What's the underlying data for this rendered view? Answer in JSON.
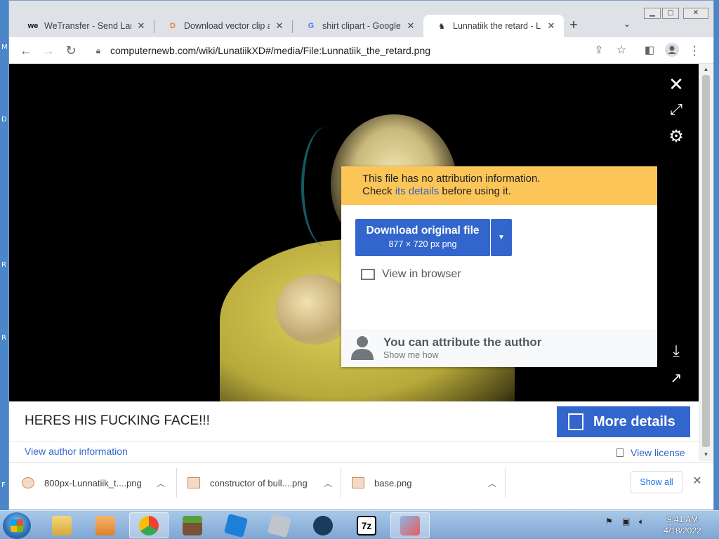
{
  "browser": {
    "tabs": [
      {
        "title": "WeTransfer - Send Large",
        "favicon": "wetransfer-icon"
      },
      {
        "title": "Download vector clip art",
        "favicon": "vector-site-icon"
      },
      {
        "title": "shirt clipart - Google Sea",
        "favicon": "google-icon"
      },
      {
        "title": "Lunnatiik the retard - Lu",
        "favicon": "wiki-icon",
        "active": true
      }
    ],
    "url": "computernewb.com/wiki/LunatiikXD#/media/File:Lunnatiik_the_retard.png"
  },
  "viewer": {
    "warning_line1": "This file has no attribution information.",
    "warning_check": "Check ",
    "warning_link": "its details",
    "warning_after": " before using it.",
    "download_label": "Download original file",
    "download_sub": "877 × 720 px png",
    "view_in_browser": "View in browser",
    "attrib_title": "You can attribute the author",
    "attrib_sub": "Show me how",
    "caption": "HERES HIS FUCKING FACE!!!",
    "more_details": "More details",
    "author_info": "View author information",
    "view_license": "View license"
  },
  "downloads": [
    {
      "name": "800px-Lunnatiik_t....png"
    },
    {
      "name": "constructor of bull....png"
    },
    {
      "name": "base.png"
    }
  ],
  "shelf": {
    "show_all": "Show all"
  },
  "taskbar": {
    "time": "9:41 AM",
    "date": "4/18/2022"
  },
  "colors": {
    "wiki_blue": "#3366cc",
    "warning_yellow": "#fcc558",
    "chrome_tabstrip": "#dee1e6"
  }
}
